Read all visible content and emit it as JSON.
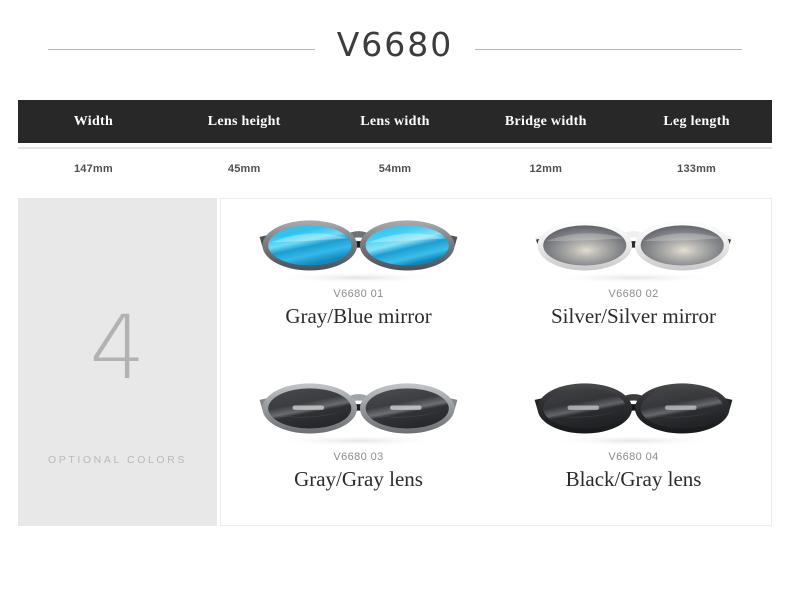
{
  "header": {
    "title": "V6680",
    "rule_left": "decorative-rule",
    "rule_right": "decorative-rule"
  },
  "spec_table": {
    "headers": [
      "Width",
      "Lens height",
      "Lens width",
      "Bridge width",
      "Leg length"
    ],
    "values": [
      "147mm",
      "45mm",
      "54mm",
      "12mm",
      "133mm"
    ]
  },
  "optional_colors_panel": {
    "count": "4",
    "label": "OPTIONAL COLORS"
  },
  "colors": [
    {
      "sku": "V6680 01",
      "name": "Gray/Blue mirror",
      "frame_color": "#6f7276",
      "lens_color": "#22b6e6",
      "icon": "sunglasses-icon"
    },
    {
      "sku": "V6680 02",
      "name": "Silver/Silver mirror",
      "frame_color": "#e9e9e9",
      "lens_color": "#8e9094",
      "icon": "sunglasses-icon"
    },
    {
      "sku": "V6680 03",
      "name": "Gray/Gray lens",
      "frame_color": "#9a9da1",
      "lens_color": "#3b3d40",
      "icon": "sunglasses-icon"
    },
    {
      "sku": "V6680 04",
      "name": "Black/Gray lens",
      "frame_color": "#2b2c2e",
      "lens_color": "#343639",
      "icon": "sunglasses-icon"
    }
  ],
  "theme": {
    "header_bar_bg": "#282828",
    "panel_bg": "#e8e8e8",
    "rule_color": "#b6b6b6",
    "title_color": "#3c3c3c"
  }
}
